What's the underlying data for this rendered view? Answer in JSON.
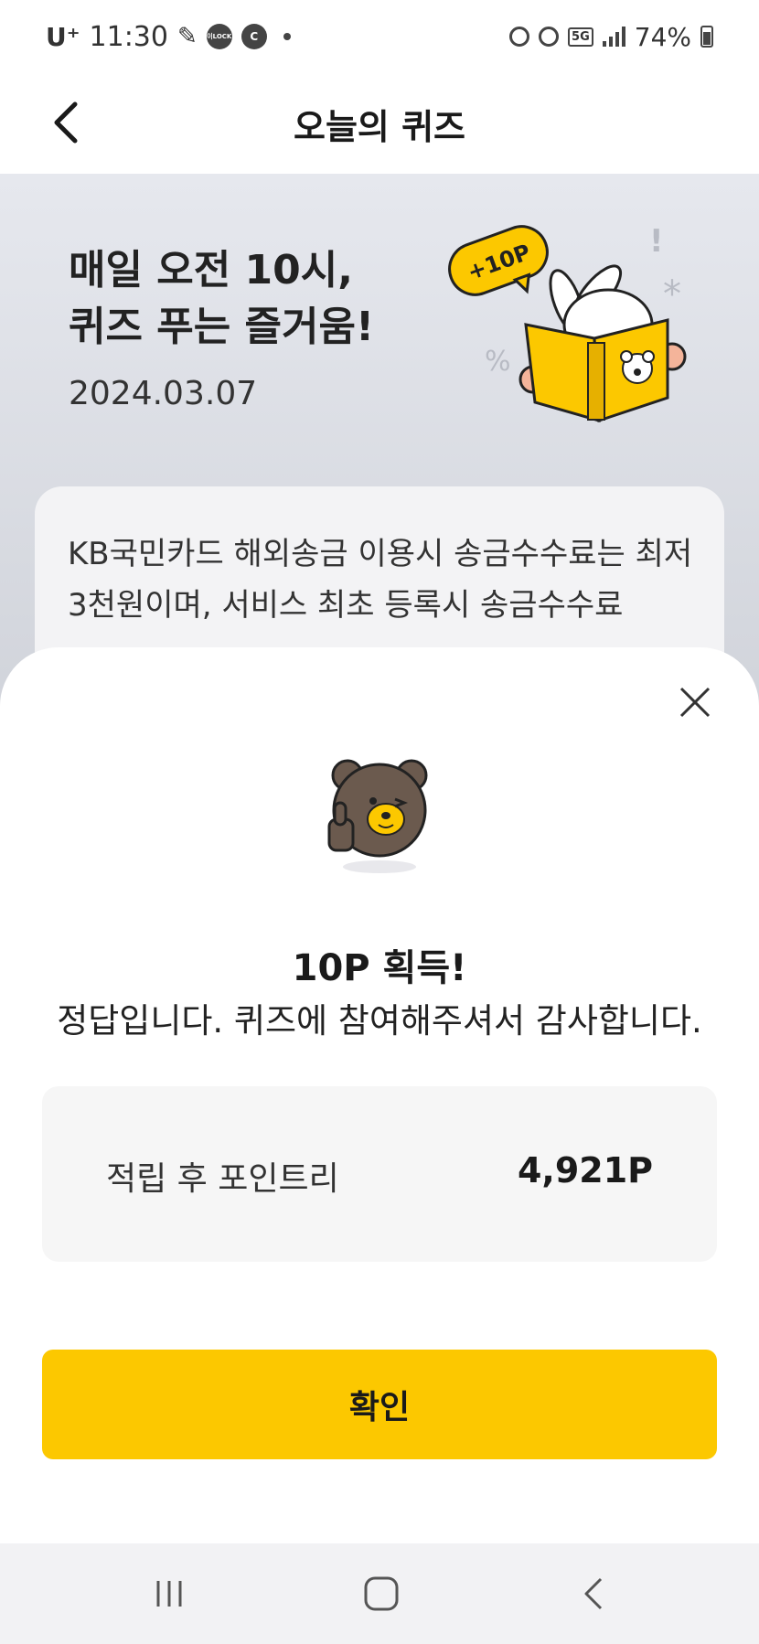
{
  "status_bar": {
    "carrier": "U⁺",
    "time": "11:30",
    "icon_lock_label": "이LOCK",
    "icon_c_label": "C",
    "network": "5G",
    "battery": "74%"
  },
  "header": {
    "title": "오늘의 퀴즈"
  },
  "hero": {
    "title": "매일 오전 10시,\n퀴즈 푸는 즐거움!",
    "date": "2024.03.07",
    "badge": "+10P"
  },
  "question": {
    "text": "KB국민카드 해외송금 이용시 송금수수료는 최저 3천원이며, 서비스 최초 등록시 송금수수료"
  },
  "result_sheet": {
    "reward_title": "10P 획득!",
    "message": "정답입니다. 퀴즈에 참여해주셔서 감사합니다.",
    "points_label": "적립 후 포인트리",
    "points_value": "4,921P",
    "confirm_label": "확인"
  },
  "colors": {
    "accent": "#fcc800",
    "hero_bg": "#e6e8ee",
    "sheet_bg": "#ffffff",
    "points_box_bg": "#f6f6f6"
  },
  "icons": {
    "back": "chevron-left-icon",
    "close": "close-icon",
    "nav_recents": "recents-icon",
    "nav_home": "home-icon",
    "nav_back": "back-icon"
  }
}
